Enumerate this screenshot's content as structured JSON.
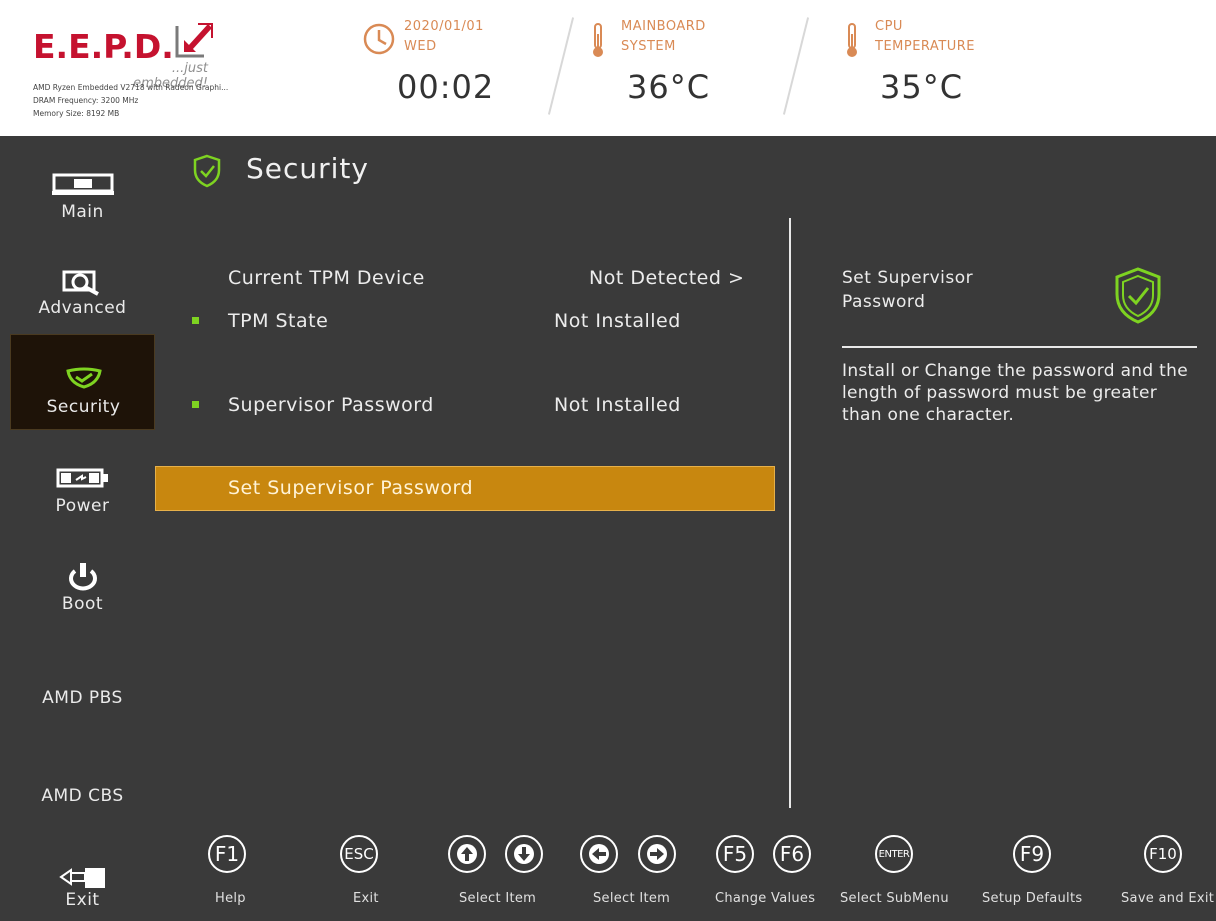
{
  "header": {
    "brand": "E.E.P.D.",
    "tagline": "...just embedded!",
    "cpu_model": "AMD Ryzen Embedded V2718 with Radeon Graphi...",
    "dram": "DRAM Frequency: 3200 MHz",
    "memory": "Memory Size: 8192 MB",
    "date": "2020/01/01",
    "weekday": "WED",
    "time": "00:02",
    "mainboard_label_1": "MAINBOARD",
    "mainboard_label_2": "SYSTEM",
    "mainboard_temp": "36°C",
    "cpu_label_1": "CPU",
    "cpu_label_2": "TEMPERATURE",
    "cpu_temp": "35°C",
    "accent_color": "#d98a55",
    "brand_color": "#c5122f"
  },
  "sidebar": {
    "items": [
      {
        "label": "Main",
        "icon": "monitor-icon"
      },
      {
        "label": "Advanced",
        "icon": "magnifier-doc-icon"
      },
      {
        "label": "Security",
        "icon": "shield-icon"
      },
      {
        "label": "Power",
        "icon": "battery-icon"
      },
      {
        "label": "Boot",
        "icon": "power-icon"
      },
      {
        "label": "AMD PBS",
        "icon": ""
      },
      {
        "label": "AMD CBS",
        "icon": ""
      },
      {
        "label": "Exit",
        "icon": "exit-plug-icon"
      }
    ],
    "active": "Security"
  },
  "main": {
    "title": "Security",
    "rows": [
      {
        "label": "Current TPM Device",
        "value": "Not Detected >"
      },
      {
        "label": "TPM State",
        "value": "Not Installed"
      },
      {
        "label": "Supervisor Password",
        "value": "Not Installed"
      }
    ],
    "selected_item": "Set Supervisor Password",
    "selected_color": "#c8870f",
    "bullet_color": "#7ed321"
  },
  "help": {
    "title": "Set Supervisor Password",
    "description": "Install or Change the password and the length of password  must be greater than one character."
  },
  "footer": {
    "keys": [
      {
        "key": "F1",
        "label": "Help"
      },
      {
        "key": "ESC",
        "label": "Exit"
      },
      {
        "key": "up-arrow-icon / down-arrow-icon",
        "label": "Select Item"
      },
      {
        "key": "left-arrow-icon / right-arrow-icon",
        "label": "Select Item"
      },
      {
        "key": "F5 / F6",
        "label": "Change Values"
      },
      {
        "key": "ENTER",
        "label": "Select  SubMenu"
      },
      {
        "key": "F9",
        "label": "Setup Defaults"
      },
      {
        "key": "F10",
        "label": "Save and Exit"
      }
    ],
    "f1": "F1",
    "esc": "ESC",
    "f5": "F5",
    "f6": "F6",
    "enter": "ENTER",
    "f9": "F9",
    "f10": "F10"
  }
}
